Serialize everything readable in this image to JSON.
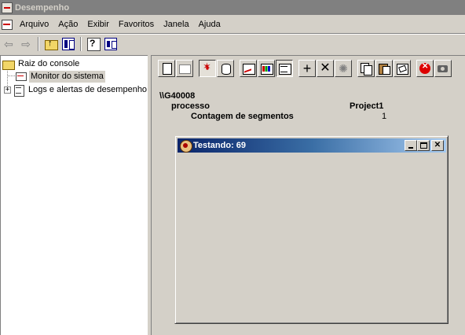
{
  "window": {
    "title": "Desempenho"
  },
  "menu": [
    "Arquivo",
    "Ação",
    "Exibir",
    "Favoritos",
    "Janela",
    "Ajuda"
  ],
  "tree": {
    "root": "Raiz do console",
    "monitor": "Monitor do sistema",
    "logs": "Logs e alertas de desempenho",
    "expander": "+"
  },
  "report": {
    "computer": "\\\\G40008",
    "object": "processo",
    "instance": "Project1",
    "counter": "Contagem de segmentos",
    "value": "1"
  },
  "child_window": {
    "title": "Testando: 69"
  }
}
